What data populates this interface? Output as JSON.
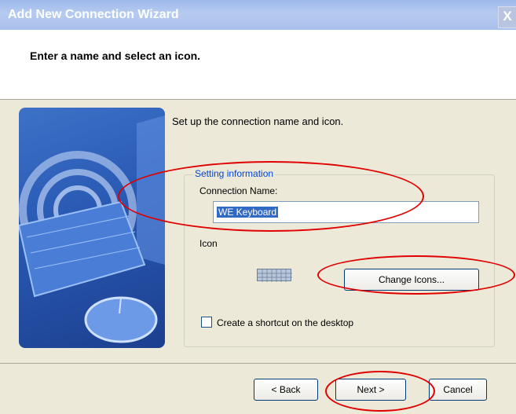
{
  "window": {
    "title": "Add New Connection Wizard",
    "close_glyph": "X"
  },
  "header": {
    "title": "Enter a name and select an icon."
  },
  "intro": "Set up the connection name and icon.",
  "group": {
    "legend": "Setting information",
    "name_label": "Connection Name:",
    "name_value": "WE Keyboard",
    "icon_label": "Icon",
    "icon_name": "keyboard-icon",
    "change_icons": "Change Icons...",
    "shortcut_label": "Create a shortcut on the desktop",
    "shortcut_checked": false
  },
  "buttons": {
    "back": "< Back",
    "next": "Next >",
    "cancel": "Cancel"
  },
  "annotation_color": "#e00000"
}
